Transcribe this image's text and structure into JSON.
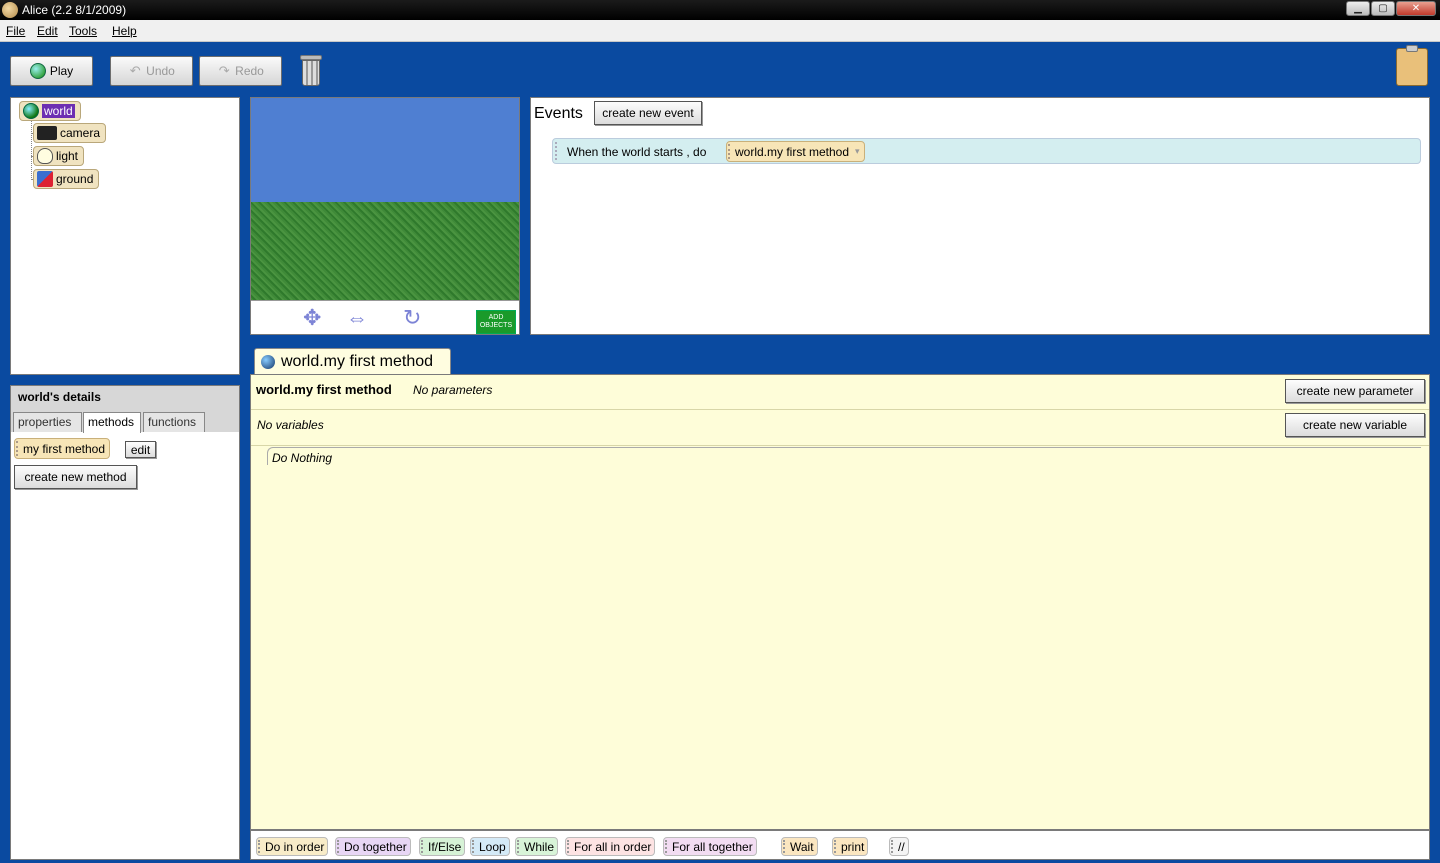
{
  "window": {
    "title": "Alice (2.2  8/1/2009)"
  },
  "menu": [
    "File",
    "Edit",
    "Tools",
    "Help"
  ],
  "toolbar": {
    "play": "Play",
    "undo": "Undo",
    "redo": "Redo"
  },
  "tree": {
    "world": "world",
    "camera": "camera",
    "light": "light",
    "ground": "ground"
  },
  "scene": {
    "add_objects": "ADD OBJECTS"
  },
  "events": {
    "title": "Events",
    "create_button": "create new event",
    "row_text": "When the world starts ,  do",
    "row_method": "world.my first method"
  },
  "details": {
    "title": "world's details",
    "tabs": [
      "properties",
      "methods",
      "functions"
    ],
    "method_name": "my first method",
    "edit_label": "edit",
    "create_method": "create new method"
  },
  "editor": {
    "tab_label": "world.my first method",
    "method_name": "world.my first method",
    "params_text": "No parameters",
    "create_param": "create new parameter",
    "vars_text": "No variables",
    "create_var": "create new variable",
    "body": "Do Nothing"
  },
  "bottom": {
    "items": [
      {
        "label": "Do in order",
        "color": "#f8ecc8"
      },
      {
        "label": "Do together",
        "color": "#e8d6f5"
      },
      {
        "label": "If/Else",
        "color": "#d6f2d6"
      },
      {
        "label": "Loop",
        "color": "#d4eaf7"
      },
      {
        "label": "While",
        "color": "#d8f4d8"
      },
      {
        "label": "For all in order",
        "color": "#fde3e3"
      },
      {
        "label": "For all together",
        "color": "#f2dcf2"
      },
      {
        "label": "Wait",
        "color": "#fbe6c0"
      },
      {
        "label": "print",
        "color": "#fbe6c0"
      },
      {
        "label": "//",
        "color": "#f4f4f4"
      }
    ]
  },
  "colors": {
    "background": "#0a4aa0",
    "editor_bg": "#fefdd9",
    "event_row": "#d4eef0",
    "selected": "#6d2fb2"
  }
}
